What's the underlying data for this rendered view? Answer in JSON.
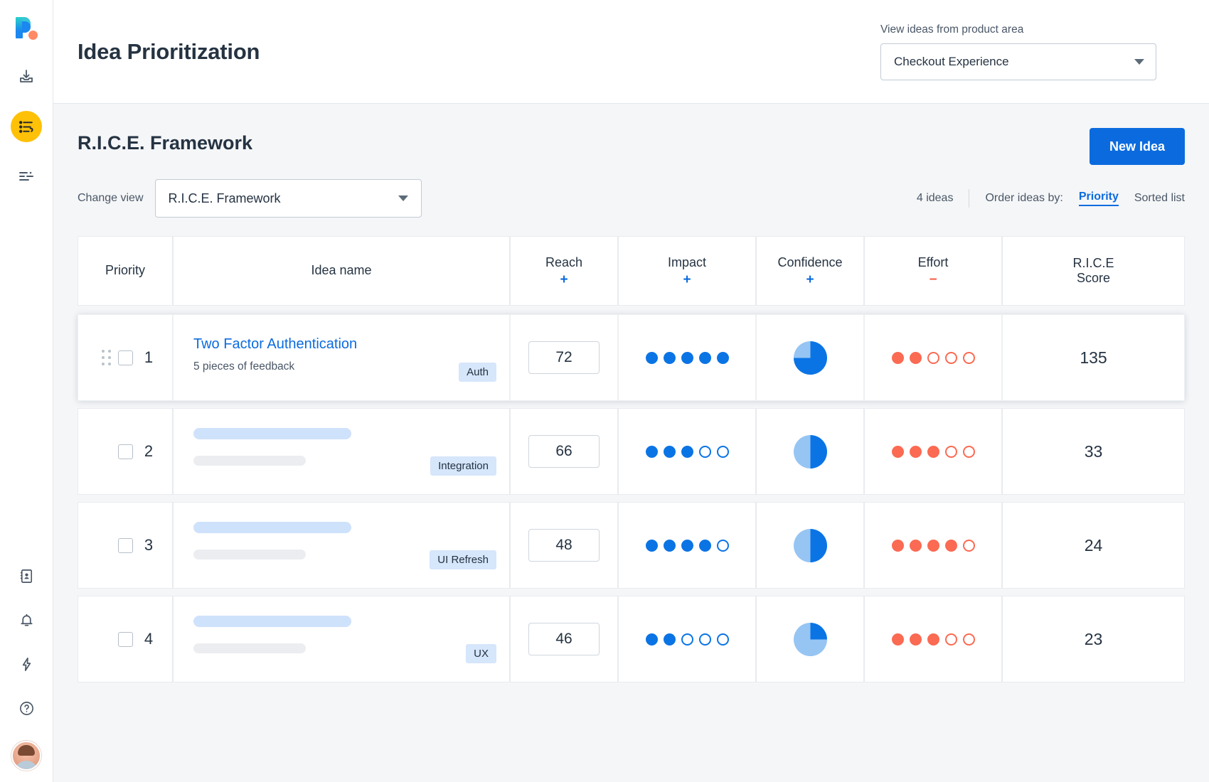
{
  "sidebar": {
    "logo_name": "roadmunk-logo",
    "items": [
      {
        "name": "import-icon",
        "glyph": "import"
      },
      {
        "name": "prioritization-icon",
        "glyph": "prioritize",
        "active": true
      },
      {
        "name": "filter-icon",
        "glyph": "filter"
      }
    ],
    "bottom_items": [
      {
        "name": "contacts-icon",
        "glyph": "contacts"
      },
      {
        "name": "notifications-icon",
        "glyph": "bell"
      },
      {
        "name": "integrations-icon",
        "glyph": "bolt"
      },
      {
        "name": "help-icon",
        "glyph": "help"
      }
    ],
    "avatar_name": "user-avatar"
  },
  "header": {
    "title": "Idea Prioritization",
    "product_area_label": "View ideas from product area",
    "product_area_value": "Checkout Experience"
  },
  "section": {
    "title": "R.I.C.E. Framework",
    "new_idea_label": "New Idea"
  },
  "toolbar": {
    "change_view_label": "Change view",
    "view_value": "R.I.C.E. Framework",
    "idea_count": "4 ideas",
    "order_label": "Order ideas by:",
    "order_priority": "Priority",
    "order_sorted": "Sorted list"
  },
  "table": {
    "columns": [
      {
        "label": "Priority",
        "sign": ""
      },
      {
        "label": "Idea name",
        "sign": ""
      },
      {
        "label": "Reach",
        "sign": "+"
      },
      {
        "label": "Impact",
        "sign": "+"
      },
      {
        "label": "Confidence",
        "sign": "+"
      },
      {
        "label": "Effort",
        "sign": "−"
      },
      {
        "label": "R.I.C.E\nScore",
        "sign": ""
      }
    ],
    "rows": [
      {
        "priority": "1",
        "idea_name": "Two Factor Authentication",
        "feedback": "5 pieces of feedback",
        "tag": "Auth",
        "reach": "72",
        "impact_filled": 5,
        "impact_total": 5,
        "confidence_percent": 75,
        "effort_filled": 2,
        "effort_total": 5,
        "score": "135",
        "featured": true
      },
      {
        "priority": "2",
        "idea_name": "",
        "feedback": "",
        "tag": "Integration",
        "reach": "66",
        "impact_filled": 3,
        "impact_total": 5,
        "confidence_percent": 50,
        "effort_filled": 3,
        "effort_total": 5,
        "score": "33",
        "featured": false
      },
      {
        "priority": "3",
        "idea_name": "",
        "feedback": "",
        "tag": "UI Refresh",
        "reach": "48",
        "impact_filled": 4,
        "impact_total": 5,
        "confidence_percent": 50,
        "effort_filled": 4,
        "effort_total": 5,
        "score": "24",
        "featured": false
      },
      {
        "priority": "4",
        "idea_name": "",
        "feedback": "",
        "tag": "UX",
        "reach": "46",
        "impact_filled": 2,
        "impact_total": 5,
        "confidence_percent": 25,
        "effort_filled": 3,
        "effort_total": 5,
        "score": "23",
        "featured": false
      }
    ]
  },
  "colors": {
    "accent_blue": "#0b6bde",
    "dot_blue": "#0b74e5",
    "dot_red": "#fb6a52",
    "pie_light": "#96c5f3",
    "active_nav": "#ffc107",
    "tag_bg": "#d6e6fb"
  }
}
